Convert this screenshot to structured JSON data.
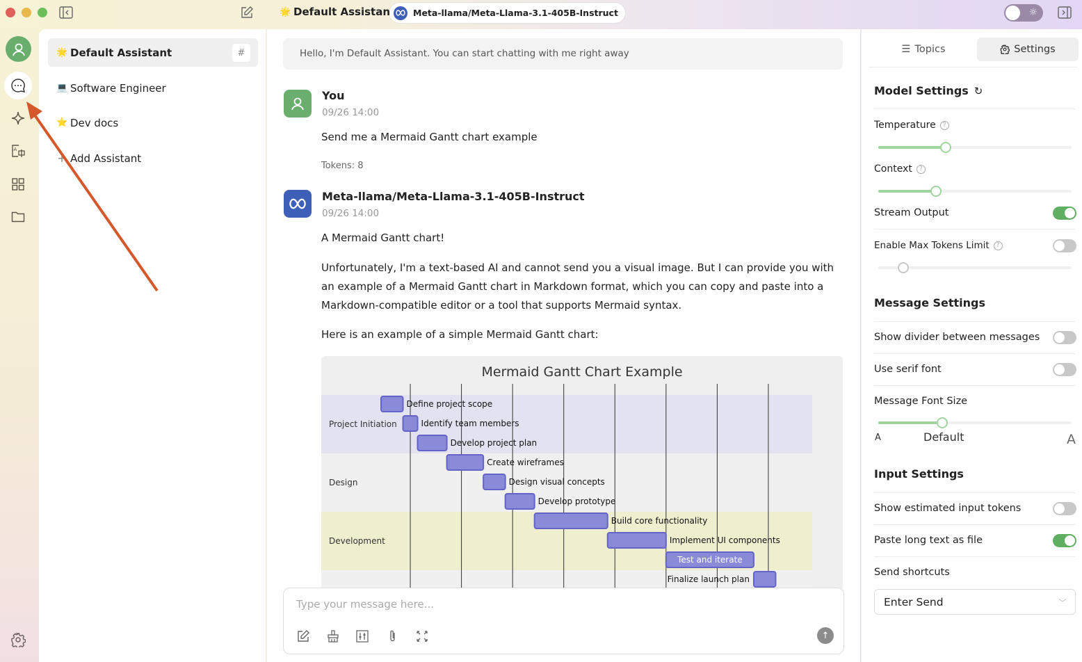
{
  "titlebar": {
    "assistant_title": "Default Assistant",
    "assistant_emoji": "🌟",
    "model_name": "Meta-llama/Meta-Llama-3.1-405B-Instruct",
    "theme_toggle_state": "light"
  },
  "rail": {
    "items": [
      {
        "name": "chat",
        "icon": "chat-bubble-icon",
        "active": true
      },
      {
        "name": "agents",
        "icon": "sparkle-icon"
      },
      {
        "name": "translate",
        "icon": "translate-icon"
      },
      {
        "name": "apps",
        "icon": "grid-icon"
      },
      {
        "name": "files",
        "icon": "folder-icon"
      }
    ],
    "bottom_icon": "gear-icon"
  },
  "assistants": {
    "items": [
      {
        "emoji": "🌟",
        "label": "Default Assistant",
        "active": true
      },
      {
        "emoji": "💻",
        "label": "Software Engineer"
      },
      {
        "emoji": "⭐",
        "label": "Dev docs"
      }
    ],
    "add_label": "Add Assistant",
    "hash_label": "#"
  },
  "chat": {
    "greeting": "Hello, I'm Default Assistant. You can start chatting with me right away",
    "messages": [
      {
        "author": "You",
        "time": "09/26 14:00",
        "text": "Send me a Mermaid Gantt chart example",
        "tokens": "Tokens: 8"
      },
      {
        "author": "Meta-llama/Meta-Llama-3.1-405B-Instruct",
        "time": "09/26 14:00",
        "paragraphs": [
          "A Mermaid Gantt chart!",
          "Unfortunately, I'm a text-based AI and cannot send you a visual image. But I can provide you with an example of a Mermaid Gantt chart in Markdown format, which you can copy and paste into a Markdown-compatible editor or a tool that supports Mermaid syntax.",
          "Here is an example of a simple Mermaid Gantt chart:"
        ]
      }
    ],
    "input_placeholder": "Type your message here...",
    "input_value": ""
  },
  "chart_data": {
    "type": "gantt",
    "title": "Mermaid Gantt Chart Example",
    "sections": [
      {
        "name": "Project Initiation",
        "color": "#e2e2f0"
      },
      {
        "name": "Design",
        "color": "#f0f0f0"
      },
      {
        "name": "Development",
        "color": "#efeecf"
      },
      {
        "name": "",
        "color": "#f0f0f0"
      }
    ],
    "tasks": [
      {
        "name": "Define project scope",
        "section": 0,
        "start": 0,
        "duration": 3
      },
      {
        "name": "Identify team members",
        "section": 0,
        "start": 3,
        "duration": 2
      },
      {
        "name": "Develop project plan",
        "section": 0,
        "start": 5,
        "duration": 4
      },
      {
        "name": "Create wireframes",
        "section": 1,
        "start": 9,
        "duration": 5
      },
      {
        "name": "Design visual concepts",
        "section": 1,
        "start": 14,
        "duration": 3
      },
      {
        "name": "Develop prototype",
        "section": 1,
        "start": 17,
        "duration": 4
      },
      {
        "name": "Build core functionality",
        "section": 2,
        "start": 21,
        "duration": 10
      },
      {
        "name": "Implement UI components",
        "section": 2,
        "start": 31,
        "duration": 8
      },
      {
        "name": "Test and iterate",
        "section": 2,
        "start": 39,
        "duration": 12
      },
      {
        "name": "Finalize launch plan",
        "section": 3,
        "start": 51,
        "duration": 3
      }
    ],
    "x_range": [
      0,
      59
    ],
    "gridlines": [
      4,
      11,
      18,
      25,
      32,
      39,
      46,
      53
    ],
    "bar_color": "#8a8ad8",
    "bar_border": "#6464c8"
  },
  "settings": {
    "tabs": [
      {
        "label": "Topics",
        "icon": "list-icon"
      },
      {
        "label": "Settings",
        "icon": "gear-icon",
        "active": true
      }
    ],
    "model_settings": {
      "title": "Model Settings",
      "temperature_label": "Temperature",
      "temperature_fraction": 0.35,
      "context_label": "Context",
      "context_fraction": 0.3,
      "stream_output_label": "Stream Output",
      "stream_output": true,
      "max_tokens_label": "Enable Max Tokens Limit",
      "max_tokens_enabled": false,
      "max_tokens_fraction": 0.13
    },
    "message_settings": {
      "title": "Message Settings",
      "show_divider_label": "Show divider between messages",
      "show_divider": false,
      "serif_font_label": "Use serif font",
      "serif_font": false,
      "font_size_label": "Message Font Size",
      "font_size_fraction": 0.33,
      "font_size_small": "A",
      "font_size_default": "Default",
      "font_size_large": "A"
    },
    "input_settings": {
      "title": "Input Settings",
      "show_tokens_label": "Show estimated input tokens",
      "show_tokens": false,
      "paste_file_label": "Paste long text as file",
      "paste_file": true,
      "send_shortcuts_label": "Send shortcuts",
      "send_shortcut_value": "Enter Send"
    }
  },
  "annotation": {
    "arrow_color": "#d4582a"
  }
}
